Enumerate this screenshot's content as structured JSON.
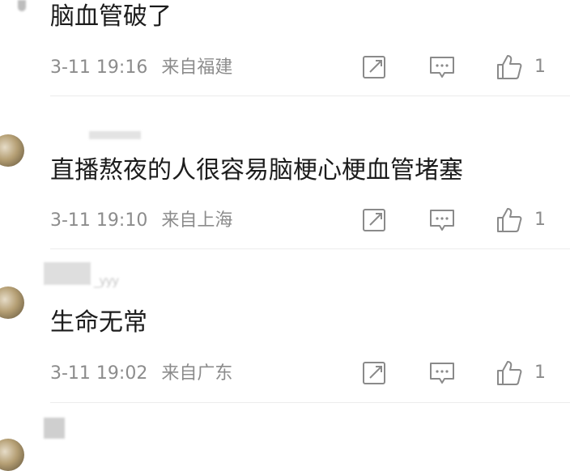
{
  "comments": [
    {
      "nickname": "",
      "content": "脑血管破了",
      "date": "3-11 19:16",
      "location": "来自福建",
      "likes": "1"
    },
    {
      "nickname": "",
      "content": "直播熬夜的人很容易脑梗心梗血管堵塞",
      "date": "3-11 19:10",
      "location": "来自上海",
      "likes": "1"
    },
    {
      "nickname": "_yyy",
      "content": "生命无常",
      "date": "3-11 19:02",
      "location": "来自广东",
      "likes": "1"
    },
    {
      "nickname": ""
    }
  ],
  "icons": {
    "share": "share-icon",
    "reply": "comment-icon",
    "like": "thumbs-up-icon"
  },
  "colors": {
    "meta_text": "#8c8c8c",
    "content_text": "#1c1c1c",
    "icon_stroke": "#8a8a8a"
  }
}
